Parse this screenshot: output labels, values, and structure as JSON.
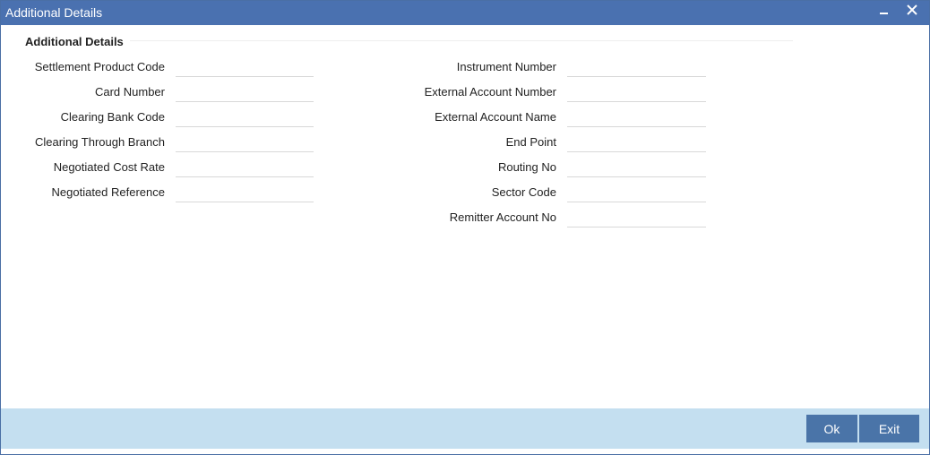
{
  "window": {
    "title": "Additional Details",
    "colors": {
      "titlebar": "#4a71b0",
      "footer": "#c4dff0",
      "button": "#4a74a8"
    }
  },
  "titlebar_icons": [
    "minimize-icon",
    "close-icon"
  ],
  "section": {
    "title": "Additional Details"
  },
  "left_fields": [
    {
      "label": "Settlement Product Code",
      "value": ""
    },
    {
      "label": "Card Number",
      "value": ""
    },
    {
      "label": "Clearing Bank Code",
      "value": ""
    },
    {
      "label": "Clearing Through Branch",
      "value": ""
    },
    {
      "label": "Negotiated Cost Rate",
      "value": ""
    },
    {
      "label": "Negotiated Reference",
      "value": ""
    }
  ],
  "right_fields": [
    {
      "label": "Instrument Number",
      "value": ""
    },
    {
      "label": "External Account Number",
      "value": ""
    },
    {
      "label": "External Account Name",
      "value": ""
    },
    {
      "label": "End Point",
      "value": ""
    },
    {
      "label": "Routing No",
      "value": ""
    },
    {
      "label": "Sector Code",
      "value": ""
    },
    {
      "label": "Remitter Account No",
      "value": ""
    }
  ],
  "footer": {
    "ok_label": "Ok",
    "exit_label": "Exit"
  }
}
